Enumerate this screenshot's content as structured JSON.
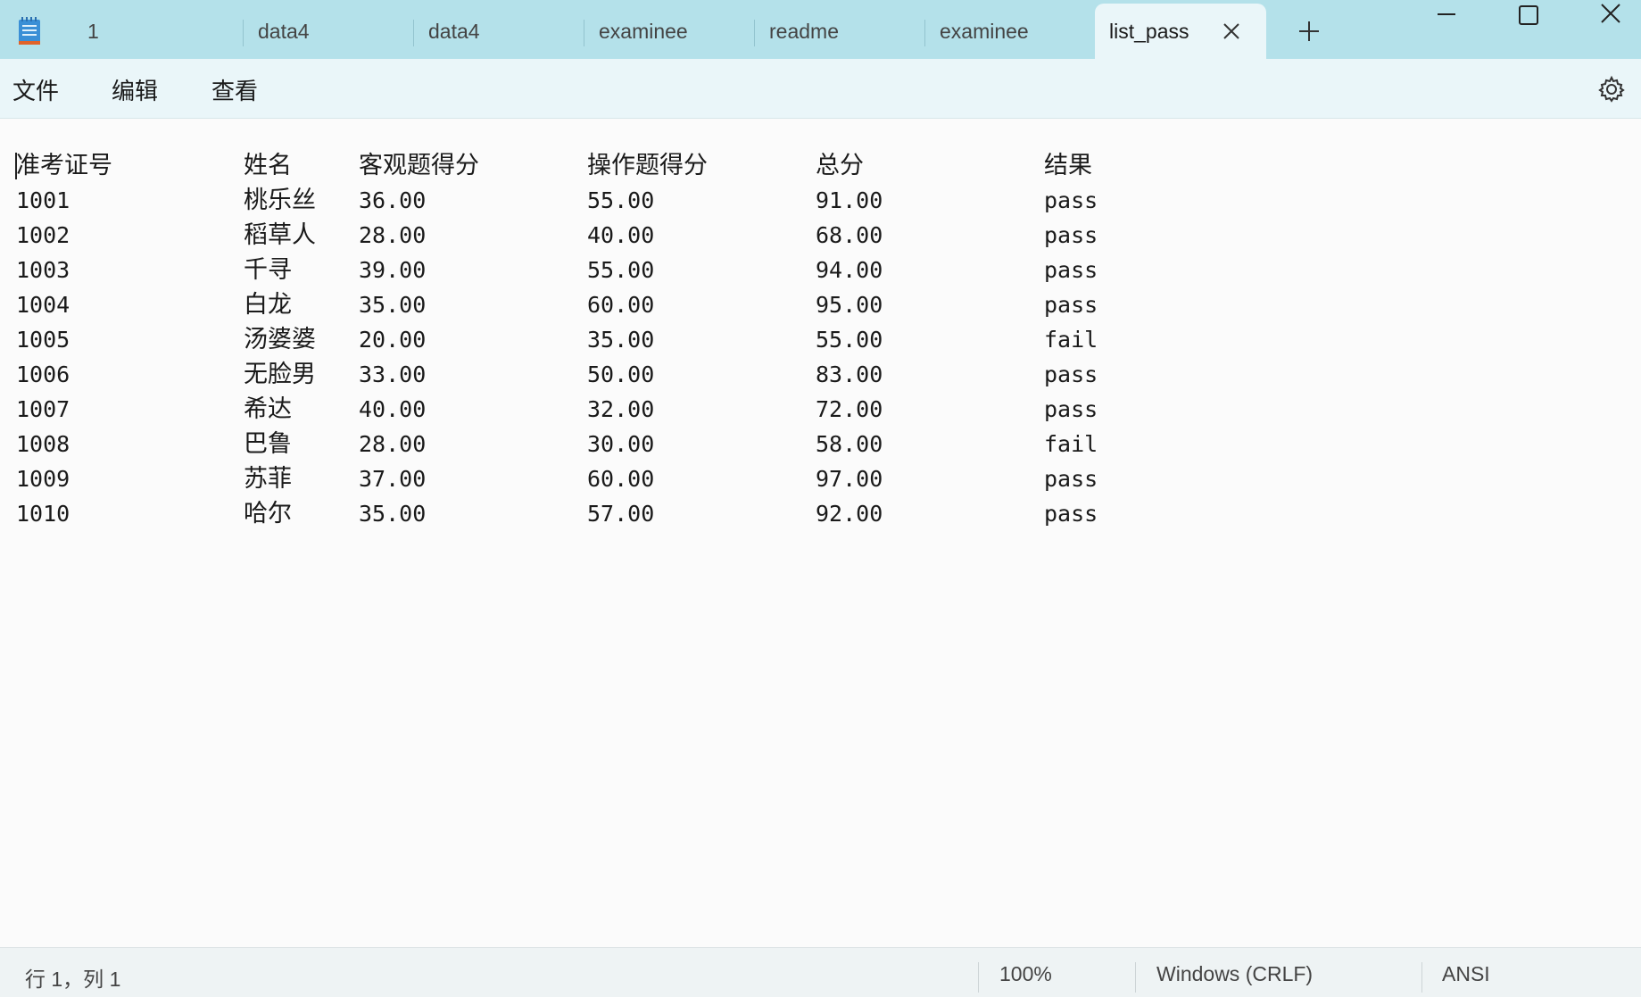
{
  "tabs": [
    {
      "label": "1"
    },
    {
      "label": "data4"
    },
    {
      "label": "data4"
    },
    {
      "label": "examinee"
    },
    {
      "label": "readme"
    },
    {
      "label": "examinee"
    },
    {
      "label": "list_pass",
      "active": true
    }
  ],
  "menu": {
    "file": "文件",
    "edit": "编辑",
    "view": "查看"
  },
  "document": {
    "header": [
      "准考证号",
      "姓名",
      "客观题得分",
      "操作题得分",
      "总分",
      "结果"
    ],
    "rows": [
      [
        "1001",
        "桃乐丝",
        "36.00",
        "55.00",
        "91.00",
        "pass"
      ],
      [
        "1002",
        "稻草人",
        "28.00",
        "40.00",
        "68.00",
        "pass"
      ],
      [
        "1003",
        "千寻",
        "39.00",
        "55.00",
        "94.00",
        "pass"
      ],
      [
        "1004",
        "白龙",
        "35.00",
        "60.00",
        "95.00",
        "pass"
      ],
      [
        "1005",
        "汤婆婆",
        "20.00",
        "35.00",
        "55.00",
        "fail"
      ],
      [
        "1006",
        "无脸男",
        "33.00",
        "50.00",
        "83.00",
        "pass"
      ],
      [
        "1007",
        "希达",
        "40.00",
        "32.00",
        "72.00",
        "pass"
      ],
      [
        "1008",
        "巴鲁",
        "28.00",
        "30.00",
        "58.00",
        "fail"
      ],
      [
        "1009",
        "苏菲",
        "37.00",
        "60.00",
        "97.00",
        "pass"
      ],
      [
        "1010",
        "哈尔",
        "35.00",
        "57.00",
        "92.00",
        "pass"
      ]
    ]
  },
  "status": {
    "position": "行 1，列 1",
    "zoom": "100%",
    "line_ending": "Windows (CRLF)",
    "encoding": "ANSI"
  },
  "icons": {
    "app": "notepad-icon",
    "close_tab": "close-icon",
    "new_tab": "plus-icon",
    "minimize": "minimize-icon",
    "maximize": "maximize-icon",
    "close_window": "close-icon",
    "settings": "gear-icon"
  },
  "colors": {
    "tabbar": "#b4e1ea",
    "active_tab": "#eaf6f9",
    "editor_bg": "#fbfbfb"
  }
}
